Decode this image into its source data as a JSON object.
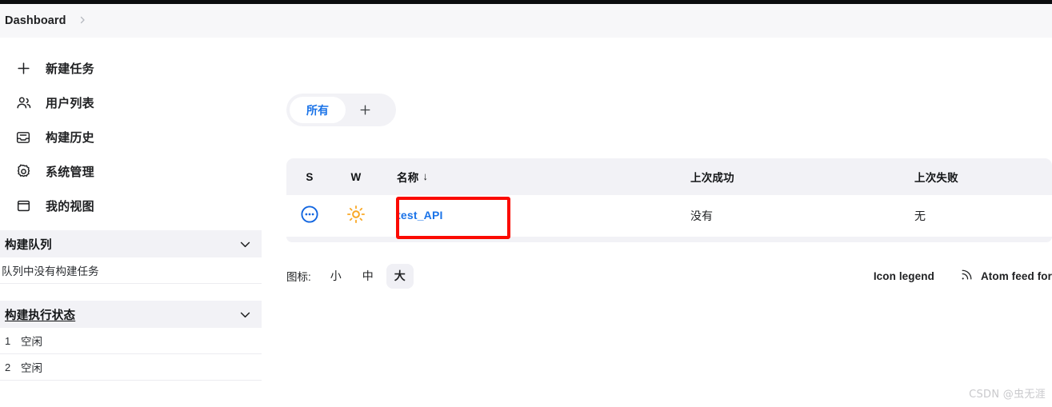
{
  "breadcrumb": {
    "root_label": "Dashboard",
    "separator": "›"
  },
  "sidebar": {
    "nav_items": [
      {
        "icon": "plus-icon",
        "label": "新建任务"
      },
      {
        "icon": "people-icon",
        "label": "用户列表"
      },
      {
        "icon": "inbox-icon",
        "label": "构建历史"
      },
      {
        "icon": "gear-icon",
        "label": "系统管理"
      },
      {
        "icon": "window-icon",
        "label": "我的视图"
      }
    ],
    "build_queue": {
      "title": "构建队列",
      "empty_text": "队列中没有构建任务"
    },
    "build_executor_status": {
      "title": "构建执行状态",
      "executors": [
        {
          "number": "1",
          "state": "空闲"
        },
        {
          "number": "2",
          "state": "空闲"
        }
      ]
    }
  },
  "main": {
    "view_tabs": {
      "active_label": "所有",
      "add_label": "+"
    },
    "table": {
      "columns": [
        {
          "key": "s",
          "label": "S"
        },
        {
          "key": "w",
          "label": "W"
        },
        {
          "key": "name",
          "label": "名称",
          "sort_indicator": "↓"
        },
        {
          "key": "last_success",
          "label": "上次成功"
        },
        {
          "key": "last_failure",
          "label": "上次失败"
        }
      ],
      "rows": [
        {
          "status_icon": "pending-dots-icon",
          "weather_icon": "sunny-icon",
          "name": "test_API",
          "last_success": "没有",
          "last_failure": "无"
        }
      ]
    },
    "footer": {
      "icon_size_label": "图标:",
      "sizes": [
        {
          "label": "小",
          "active": false
        },
        {
          "label": "中",
          "active": false
        },
        {
          "label": "大",
          "active": true
        }
      ],
      "icon_legend_label": "Icon legend",
      "atom_feed_label": "Atom feed for",
      "atom_icon": "rss-icon"
    }
  },
  "watermark": "CSDN @虫无涯",
  "colors": {
    "accent_blue": "#1a73e8",
    "annotation_red": "#fb0a01",
    "panel_gray": "#f2f2f6",
    "sun_yellow": "#f9a825"
  }
}
